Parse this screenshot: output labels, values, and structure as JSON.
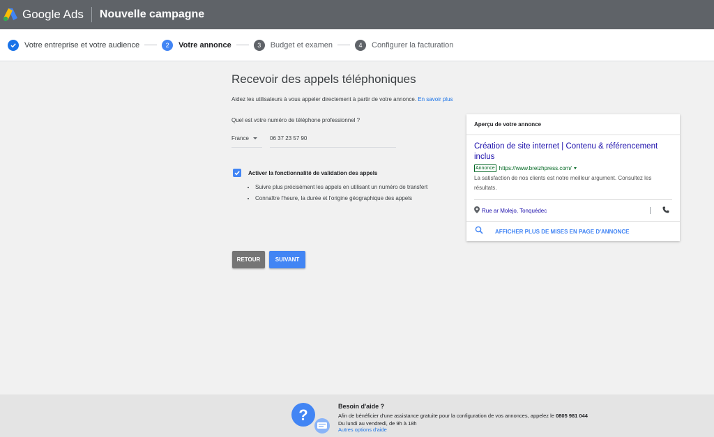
{
  "header": {
    "brand": "Google Ads",
    "campaign_title": "Nouvelle campagne",
    "colors": {
      "bar": "#5f6368",
      "logo_blue": "#4285f4",
      "logo_yellow": "#fbbc04"
    }
  },
  "stepper": {
    "steps": [
      {
        "label": "Votre entreprise et votre audience",
        "number": "",
        "state": "done"
      },
      {
        "label": "Votre annonce",
        "number": "2",
        "state": "active"
      },
      {
        "label": "Budget et examen",
        "number": "3",
        "state": "todo"
      },
      {
        "label": "Configurer la facturation",
        "number": "4",
        "state": "todo"
      }
    ]
  },
  "main": {
    "title": "Recevoir des appels téléphoniques",
    "description": "Aidez les utilisateurs à vous appeler directement à partir de votre annonce.",
    "learn_more": "En savoir plus",
    "phone_question": "Quel est votre numéro de téléphone professionnel ?",
    "country": "France",
    "phone_number": "06 37 23 57 90",
    "checkbox_label": "Activer la fonctionnalité de validation des appels",
    "checkbox_checked": true,
    "bullets": [
      "Suivre plus précisément les appels en utilisant un numéro de transfert",
      "Connaître l'heure, la durée et l'origine géographique des appels"
    ],
    "back_button": "RETOUR",
    "next_button": "SUIVANT"
  },
  "preview": {
    "header": "Aperçu de votre annonce",
    "ad_title": "Création de site internet | Contenu & référencement inclus",
    "ad_badge": "Annonce",
    "ad_url": "https://www.breizhpress.com/",
    "ad_text": "La satisfaction de nos clients est notre meilleur argument. Consultez les résultats.",
    "location": "Rue ar Molejo, Tonquédec",
    "more_label": "AFFICHER PLUS DE MISES EN PAGE D'ANNONCE"
  },
  "footer": {
    "help_title": "Besoin d'aide ?",
    "help_text_prefix": "Afin de bénéficier d'une assistance gratuite pour la configuration de vos annonces, appelez le",
    "help_phone": "0805 981 044",
    "help_hours": "Du lundi au vendredi, de 9h à 18h",
    "help_link": "Autres options d'aide"
  }
}
